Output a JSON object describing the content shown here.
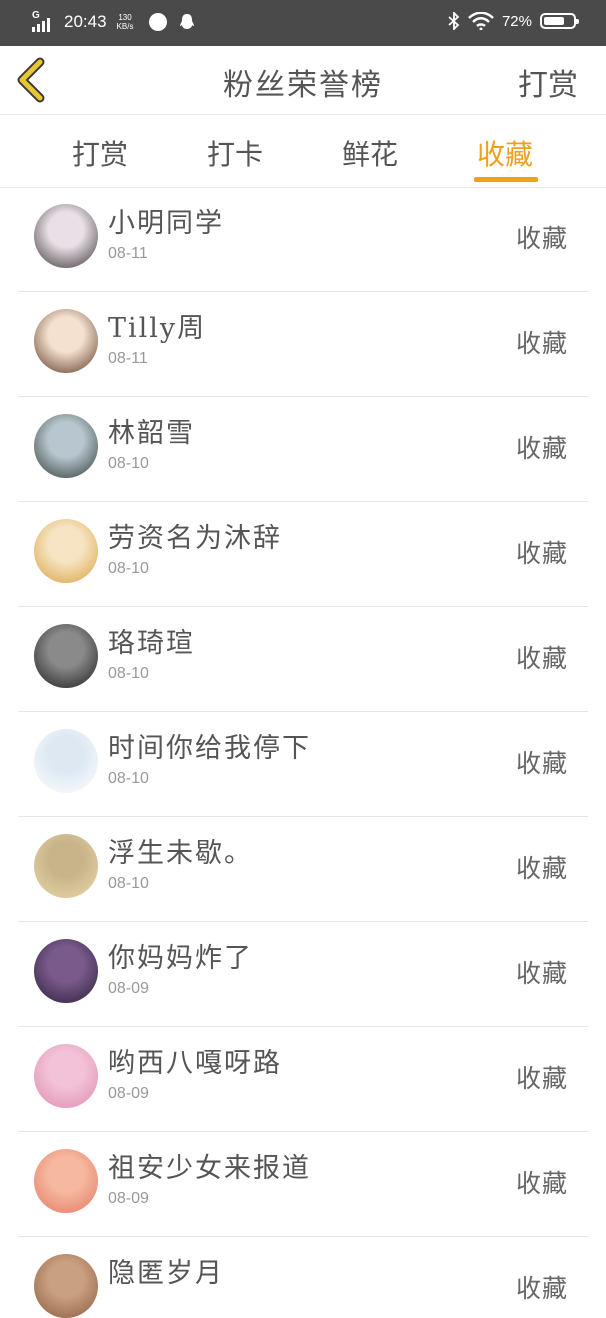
{
  "status_bar": {
    "network": "G",
    "time": "20:43",
    "speed_value": "130",
    "speed_unit": "KB/s",
    "battery": "72%",
    "battery_level": 0.72
  },
  "header": {
    "title": "粉丝荣誉榜",
    "action": "打赏"
  },
  "tabs": [
    {
      "label": "打赏",
      "active": false
    },
    {
      "label": "打卡",
      "active": false
    },
    {
      "label": "鲜花",
      "active": false
    },
    {
      "label": "收藏",
      "active": true
    }
  ],
  "fans": [
    {
      "name": "小明同学",
      "date": "08-11",
      "action": "收藏",
      "avatar_colors": [
        "#e8e0e6",
        "#3a3035"
      ]
    },
    {
      "name": "Tilly周",
      "date": "08-11",
      "action": "收藏",
      "avatar_colors": [
        "#f4e1cf",
        "#5a3520"
      ]
    },
    {
      "name": "林韶雪",
      "date": "08-10",
      "action": "收藏",
      "avatar_colors": [
        "#b8c6cf",
        "#2d3a33"
      ]
    },
    {
      "name": "劳资名为沐辞",
      "date": "08-10",
      "action": "收藏",
      "avatar_colors": [
        "#f6e4c2",
        "#d9a040"
      ]
    },
    {
      "name": "珞琦瑄",
      "date": "08-10",
      "action": "收藏",
      "avatar_colors": [
        "#8a8a8a",
        "#1c1c1c"
      ]
    },
    {
      "name": "时间你给我停下",
      "date": "08-10",
      "action": "收藏",
      "avatar_colors": [
        "#dde8f3",
        "#ffffff"
      ]
    },
    {
      "name": "浮生未歇。",
      "date": "08-10",
      "action": "收藏",
      "avatar_colors": [
        "#c9b48a",
        "#e8d9a8"
      ]
    },
    {
      "name": "你妈妈炸了",
      "date": "08-09",
      "action": "收藏",
      "avatar_colors": [
        "#7a5a8a",
        "#2a1f3a"
      ]
    },
    {
      "name": "哟西八嘎呀路",
      "date": "08-09",
      "action": "收藏",
      "avatar_colors": [
        "#f2c2d8",
        "#e08ab0"
      ]
    },
    {
      "name": "祖安少女来报道",
      "date": "08-09",
      "action": "收藏",
      "avatar_colors": [
        "#f6b8a0",
        "#e47860"
      ]
    },
    {
      "name": "隐匿岁月",
      "date": "",
      "action": "收藏",
      "avatar_colors": [
        "#c9a080",
        "#8a5a40"
      ]
    }
  ],
  "colors": {
    "accent": "#f0a11c",
    "status_bar_bg": "#4a4a4a",
    "back_arrow": "#e0c230"
  }
}
